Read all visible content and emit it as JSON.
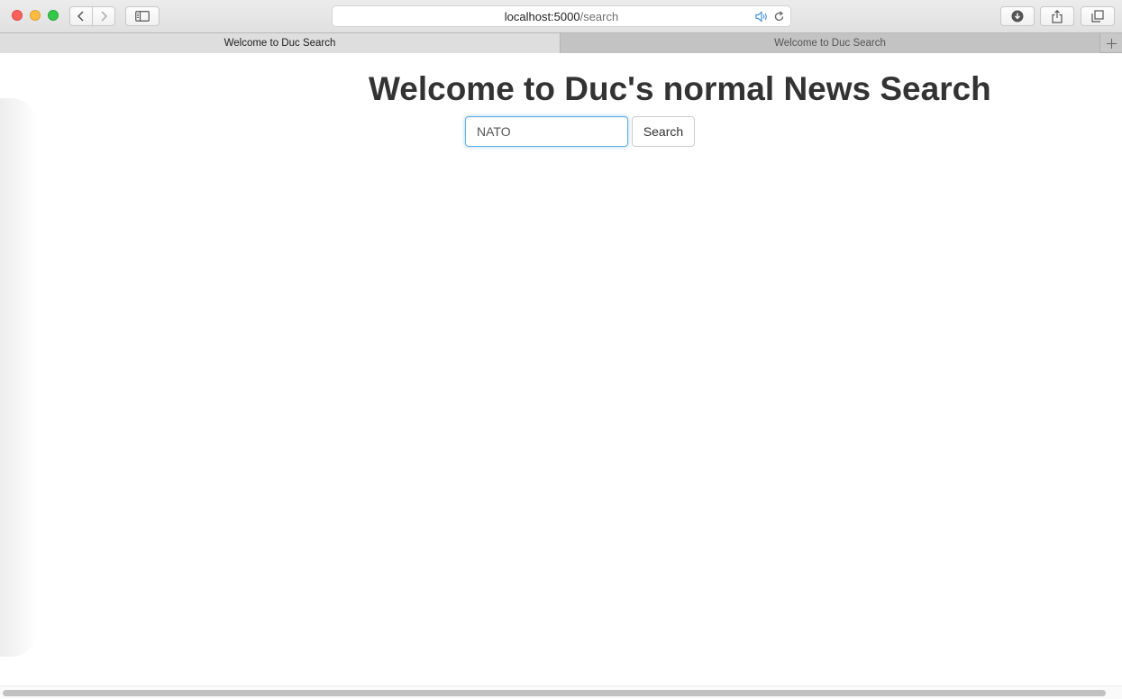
{
  "browser": {
    "url_host": "localhost:5000",
    "url_path": "/search",
    "tabs": [
      {
        "label": "Welcome to Duc Search",
        "active": true
      },
      {
        "label": "Welcome to Duc Search",
        "active": false
      }
    ],
    "icons": {
      "back": "chevron-left-icon",
      "forward": "chevron-right-icon",
      "sidebar": "sidebar-icon",
      "audio": "speaker-icon",
      "reload": "reload-icon",
      "download": "download-icon",
      "share": "share-icon",
      "tabs": "tabs-overview-icon",
      "new_tab": "plus-icon"
    },
    "colors": {
      "close": "#fc605c",
      "minimize": "#fdbc40",
      "maximize": "#34c84a",
      "audio_accent": "#4a90e2"
    }
  },
  "page": {
    "title": "Welcome to Duc's normal News Search",
    "search": {
      "value": "NATO",
      "button_label": "Search",
      "focus_color": "#66afe9"
    }
  }
}
